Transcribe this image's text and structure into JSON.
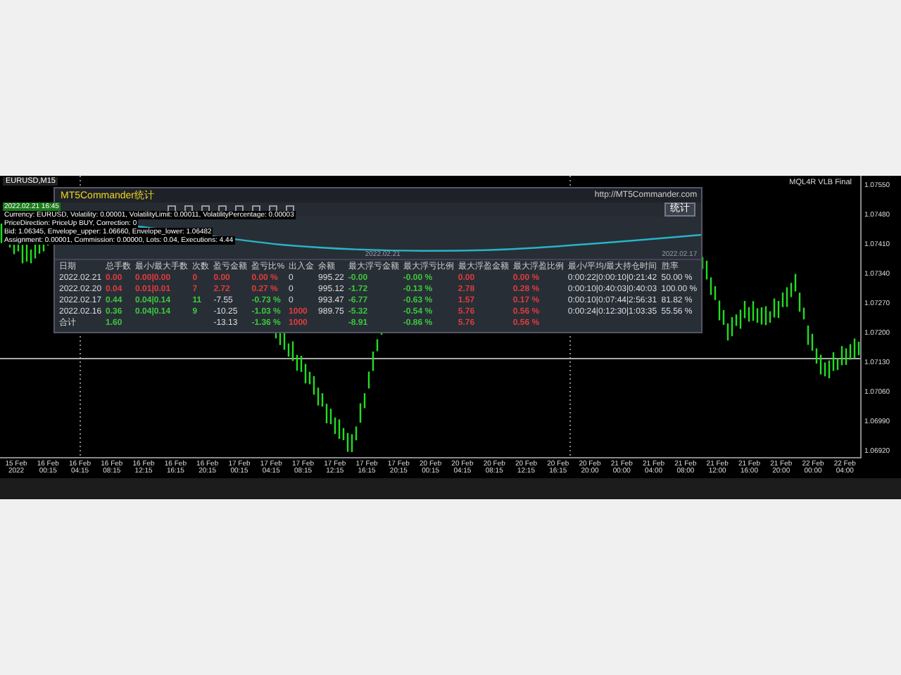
{
  "chart": {
    "symbol": "EURUSD,M15",
    "indicator": "MQL4R VLB Final",
    "info_lines": [
      "2022.02.21 16:45",
      "Currency: EURUSD, Volatility: 0.00001, VolatilityLimit: 0.00011, VolatilityPercentage: 0.00003",
      "PriceDirection: PriceUp BUY, Correction: 0",
      "Bid: 1.06345, Envelope_upper: 1.06660, Envelope_lower: 1.06482",
      "Assignment: 0.00001, Commission: 0.00000, Lots: 0.04, Executions: 4.44"
    ],
    "price_ticks": [
      "1.07550",
      "1.07480",
      "1.07410",
      "1.07340",
      "1.07270",
      "1.07200",
      "1.07130",
      "1.07060",
      "1.06990",
      "1.06920"
    ],
    "time_ticks": [
      "15 Feb 2022",
      "16 Feb 00:15",
      "16 Feb 04:15",
      "16 Feb 08:15",
      "16 Feb 12:15",
      "16 Feb 16:15",
      "16 Feb 20:15",
      "17 Feb 00:15",
      "17 Feb 04:15",
      "17 Feb 08:15",
      "17 Feb 12:15",
      "17 Feb 16:15",
      "17 Feb 20:15",
      "20 Feb 00:15",
      "20 Feb 04:15",
      "20 Feb 08:15",
      "20 Feb 12:15",
      "20 Feb 16:15",
      "20 Feb 20:00",
      "21 Feb 00:00",
      "21 Feb 04:00",
      "21 Feb 08:00",
      "21 Feb 12:00",
      "21 Feb 16:00",
      "21 Feb 20:00",
      "22 Feb 00:00",
      "22 Feb 04:00"
    ]
  },
  "stats_panel": {
    "title": "MT5Commander统计",
    "link": "http://MT5Commander.com",
    "button": "统计",
    "curve_labels": [
      "2022.02.21",
      "2022.02.17"
    ],
    "columns": [
      "日期",
      "总手数",
      "最小/最大手数",
      "次数",
      "盈亏金额",
      "盈亏比%",
      "出入金",
      "余额",
      "最大浮亏金额",
      "最大浮亏比例",
      "最大浮盈金额",
      "最大浮盈比例",
      "最小/平均/最大持仓时间",
      "胜率"
    ],
    "rows": [
      {
        "cells": [
          "2022.02.21",
          {
            "text": "0.00",
            "color": "#e03c3c"
          },
          {
            "text": "0.00|0.00",
            "color": "#e03c3c"
          },
          {
            "text": "0",
            "color": "#e03c3c"
          },
          {
            "text": "0.00",
            "color": "#e03c3c"
          },
          {
            "text": "0.00 %",
            "color": "#e03c3c"
          },
          "0",
          "995.22",
          {
            "text": "-0.00",
            "color": "#3cc83c"
          },
          {
            "text": "-0.00 %",
            "color": "#3cc83c"
          },
          {
            "text": "0.00",
            "color": "#e03c3c"
          },
          {
            "text": "0.00 %",
            "color": "#e03c3c"
          },
          "0:00:22|0:00:10|0:21:42",
          "50.00 %"
        ]
      },
      {
        "cells": [
          "2022.02.20",
          {
            "text": "0.04",
            "color": "#e03c3c"
          },
          {
            "text": "0.01|0.01",
            "color": "#e03c3c"
          },
          {
            "text": "7",
            "color": "#e03c3c"
          },
          {
            "text": "2.72",
            "color": "#e03c3c"
          },
          {
            "text": "0.27 %",
            "color": "#e03c3c"
          },
          "0",
          "995.12",
          {
            "text": "-1.72",
            "color": "#3cc83c"
          },
          {
            "text": "-0.13 %",
            "color": "#3cc83c"
          },
          {
            "text": "2.78",
            "color": "#e03c3c"
          },
          {
            "text": "0.28 %",
            "color": "#e03c3c"
          },
          "0:00:10|0:40:03|0:40:03",
          "100.00 %"
        ]
      },
      {
        "cells": [
          "2022.02.17",
          {
            "text": "0.44",
            "color": "#3cc83c"
          },
          {
            "text": "0.04|0.14",
            "color": "#3cc83c"
          },
          {
            "text": "11",
            "color": "#3cc83c"
          },
          "-7.55",
          {
            "text": "-0.73 %",
            "color": "#3cc83c"
          },
          "0",
          "993.47",
          {
            "text": "-6.77",
            "color": "#3cc83c"
          },
          {
            "text": "-0.63 %",
            "color": "#3cc83c"
          },
          {
            "text": "1.57",
            "color": "#e03c3c"
          },
          {
            "text": "0.17 %",
            "color": "#e03c3c"
          },
          "0:00:10|0:07:44|2:56:31",
          "81.82 %"
        ]
      },
      {
        "cells": [
          "2022.02.16",
          {
            "text": "0.36",
            "color": "#3cc83c"
          },
          {
            "text": "0.04|0.14",
            "color": "#3cc83c"
          },
          {
            "text": "9",
            "color": "#3cc83c"
          },
          "-10.25",
          {
            "text": "-1.03 %",
            "color": "#3cc83c"
          },
          {
            "text": "1000",
            "color": "#e03c3c"
          },
          "989.75",
          {
            "text": "-5.32",
            "color": "#3cc83c"
          },
          {
            "text": "-0.54 %",
            "color": "#3cc83c"
          },
          {
            "text": "5.76",
            "color": "#e03c3c"
          },
          {
            "text": "0.56 %",
            "color": "#e03c3c"
          },
          "0:00:24|0:12:30|1:03:35",
          "55.56 %"
        ]
      },
      {
        "cells": [
          "合计",
          {
            "text": "1.60",
            "color": "#3cc83c"
          },
          "",
          "",
          "-13.13",
          {
            "text": "-1.36 %",
            "color": "#3cc83c"
          },
          {
            "text": "1000",
            "color": "#e03c3c"
          },
          "",
          {
            "text": "-8.91",
            "color": "#3cc83c"
          },
          {
            "text": "-0.86 %",
            "color": "#3cc83c"
          },
          {
            "text": "5.76",
            "color": "#e03c3c"
          },
          {
            "text": "0.56 %",
            "color": "#e03c3c"
          },
          "",
          ""
        ]
      }
    ]
  }
}
